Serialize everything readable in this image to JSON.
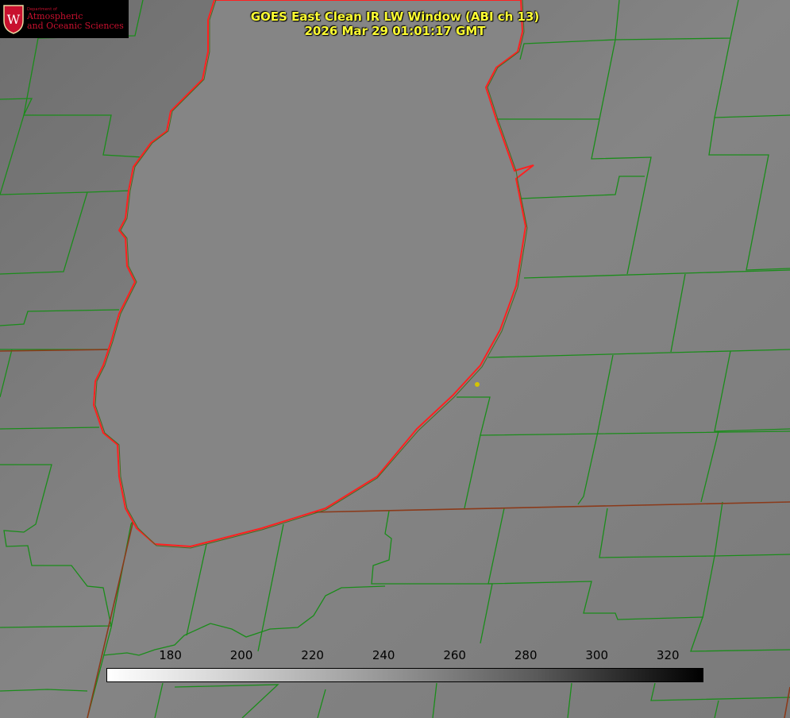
{
  "logo": {
    "department": "Department of",
    "line1": "Atmospheric",
    "line2": "and Oceanic Sciences",
    "seal_letter": "W",
    "color": "#c8102e"
  },
  "title": {
    "line1": "GOES East Clean IR LW Window (ABI ch 13)",
    "line2": "2026 Mar 29 01:01:17 GMT",
    "color": "#ffff33"
  },
  "colorbar": {
    "ticks": [
      "180",
      "200",
      "220",
      "240",
      "260",
      "280",
      "300",
      "320"
    ],
    "min": 162,
    "max": 330
  },
  "map": {
    "lake": "icon:lake-outline",
    "county_line_color": "#1a8c1a",
    "state_line_color": "#8b3a1a",
    "shoreline_color": "#ff2020",
    "marker_color": "#d4c400"
  }
}
